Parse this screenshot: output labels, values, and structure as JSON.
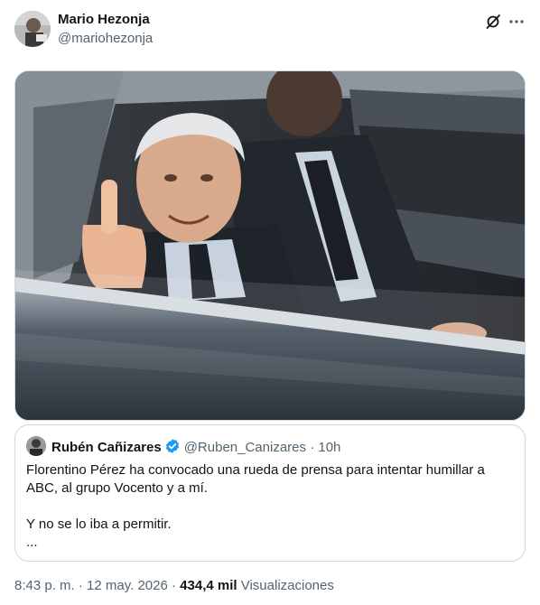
{
  "tweet": {
    "author_name": "Mario Hezonja",
    "author_handle": "@mariohezonja",
    "icons": {
      "grok": "grok-icon",
      "more": "more-options-icon"
    }
  },
  "media": {
    "type": "photo"
  },
  "quote": {
    "author_name": "Rubén Cañizares",
    "verified": true,
    "verified_color": "#1d9bf0",
    "author_handle": "@Ruben_Canizares",
    "separator": "·",
    "time": "10h",
    "lines": [
      "Florentino Pérez ha convocado una rueda de prensa para intentar humillar a",
      "ABC, al grupo Vocento y a mí.",
      "Y no se lo iba a permitir.",
      "..."
    ]
  },
  "footer": {
    "time": "8:43 p. m.",
    "dot1": "·",
    "date": "12 may. 2026",
    "dot2": "·",
    "views_count": "434,4 mil",
    "views_label": "Visualizaciones"
  }
}
